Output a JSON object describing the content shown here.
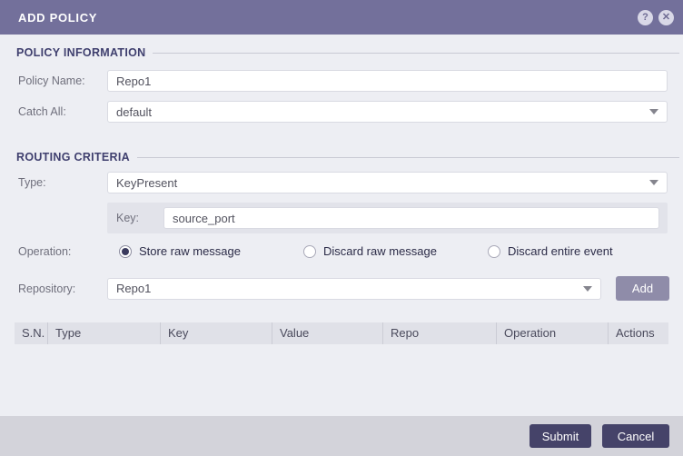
{
  "dialog": {
    "title": "ADD POLICY",
    "icons": {
      "help": "?",
      "close": "✕"
    }
  },
  "sections": {
    "policy_information": "POLICY INFORMATION",
    "routing_criteria": "ROUTING CRITERIA"
  },
  "fields": {
    "policy_name": {
      "label": "Policy Name:",
      "value": "Repo1"
    },
    "catch_all": {
      "label": "Catch All:",
      "value": "default"
    },
    "type": {
      "label": "Type:",
      "value": "KeyPresent"
    },
    "key": {
      "label": "Key:",
      "value": "source_port"
    },
    "operation": {
      "label": "Operation:",
      "options": [
        {
          "label": "Store raw message",
          "selected": true
        },
        {
          "label": "Discard raw message",
          "selected": false
        },
        {
          "label": "Discard entire event",
          "selected": false
        }
      ]
    },
    "repository": {
      "label": "Repository:",
      "value": "Repo1",
      "add_button_label": "Add"
    }
  },
  "table": {
    "columns": [
      "S.N.",
      "Type",
      "Key",
      "Value",
      "Repo",
      "Operation",
      "Actions"
    ],
    "rows": []
  },
  "footer": {
    "submit_label": "Submit",
    "cancel_label": "Cancel"
  },
  "colors": {
    "header_bg": "#73709B",
    "body_bg": "#EDEEF3",
    "footer_bg": "#D3D3DA",
    "button_bg": "#454369",
    "add_button_bg": "#8F8CA9",
    "section_title": "#3F3F6E",
    "radio_dot": "#3B3B5E"
  }
}
